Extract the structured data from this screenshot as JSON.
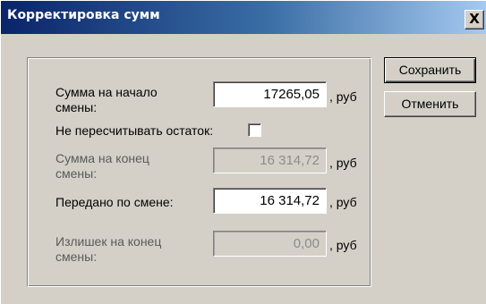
{
  "window": {
    "title": "Корректировка сумм",
    "close_label": "X"
  },
  "form": {
    "start_sum": {
      "label": "Сумма на начало смены:",
      "value": "17265,05",
      "unit": ", руб"
    },
    "no_recalc": {
      "label": "Не пересчитывать остаток:",
      "checked": false
    },
    "end_sum": {
      "label": "Сумма на конец смены:",
      "value": "16 314,72",
      "unit": ", руб",
      "disabled": true
    },
    "handed_over": {
      "label": "Передано по смене:",
      "value": "16 314,72",
      "unit": ", руб"
    },
    "surplus": {
      "label": "Излишек на конец смены:",
      "value": "0,00",
      "unit": ", руб",
      "disabled": true
    }
  },
  "buttons": {
    "save_label": "Сохранить",
    "cancel_label": "Отменить"
  },
  "colors": {
    "titlebar_start": "#0a246a",
    "titlebar_end": "#a6caf0",
    "face": "#d4d0c8"
  }
}
